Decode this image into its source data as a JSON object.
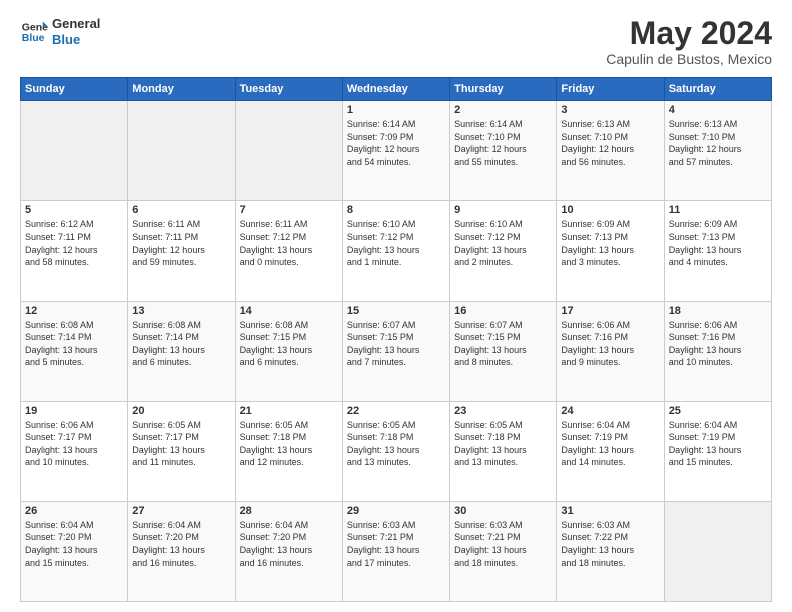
{
  "logo": {
    "line1": "General",
    "line2": "Blue"
  },
  "title": "May 2024",
  "subtitle": "Capulin de Bustos, Mexico",
  "header_days": [
    "Sunday",
    "Monday",
    "Tuesday",
    "Wednesday",
    "Thursday",
    "Friday",
    "Saturday"
  ],
  "weeks": [
    {
      "days": [
        {
          "num": "",
          "info": ""
        },
        {
          "num": "",
          "info": ""
        },
        {
          "num": "",
          "info": ""
        },
        {
          "num": "1",
          "info": "Sunrise: 6:14 AM\nSunset: 7:09 PM\nDaylight: 12 hours\nand 54 minutes."
        },
        {
          "num": "2",
          "info": "Sunrise: 6:14 AM\nSunset: 7:10 PM\nDaylight: 12 hours\nand 55 minutes."
        },
        {
          "num": "3",
          "info": "Sunrise: 6:13 AM\nSunset: 7:10 PM\nDaylight: 12 hours\nand 56 minutes."
        },
        {
          "num": "4",
          "info": "Sunrise: 6:13 AM\nSunset: 7:10 PM\nDaylight: 12 hours\nand 57 minutes."
        }
      ]
    },
    {
      "days": [
        {
          "num": "5",
          "info": "Sunrise: 6:12 AM\nSunset: 7:11 PM\nDaylight: 12 hours\nand 58 minutes."
        },
        {
          "num": "6",
          "info": "Sunrise: 6:11 AM\nSunset: 7:11 PM\nDaylight: 12 hours\nand 59 minutes."
        },
        {
          "num": "7",
          "info": "Sunrise: 6:11 AM\nSunset: 7:12 PM\nDaylight: 13 hours\nand 0 minutes."
        },
        {
          "num": "8",
          "info": "Sunrise: 6:10 AM\nSunset: 7:12 PM\nDaylight: 13 hours\nand 1 minute."
        },
        {
          "num": "9",
          "info": "Sunrise: 6:10 AM\nSunset: 7:12 PM\nDaylight: 13 hours\nand 2 minutes."
        },
        {
          "num": "10",
          "info": "Sunrise: 6:09 AM\nSunset: 7:13 PM\nDaylight: 13 hours\nand 3 minutes."
        },
        {
          "num": "11",
          "info": "Sunrise: 6:09 AM\nSunset: 7:13 PM\nDaylight: 13 hours\nand 4 minutes."
        }
      ]
    },
    {
      "days": [
        {
          "num": "12",
          "info": "Sunrise: 6:08 AM\nSunset: 7:14 PM\nDaylight: 13 hours\nand 5 minutes."
        },
        {
          "num": "13",
          "info": "Sunrise: 6:08 AM\nSunset: 7:14 PM\nDaylight: 13 hours\nand 6 minutes."
        },
        {
          "num": "14",
          "info": "Sunrise: 6:08 AM\nSunset: 7:15 PM\nDaylight: 13 hours\nand 6 minutes."
        },
        {
          "num": "15",
          "info": "Sunrise: 6:07 AM\nSunset: 7:15 PM\nDaylight: 13 hours\nand 7 minutes."
        },
        {
          "num": "16",
          "info": "Sunrise: 6:07 AM\nSunset: 7:15 PM\nDaylight: 13 hours\nand 8 minutes."
        },
        {
          "num": "17",
          "info": "Sunrise: 6:06 AM\nSunset: 7:16 PM\nDaylight: 13 hours\nand 9 minutes."
        },
        {
          "num": "18",
          "info": "Sunrise: 6:06 AM\nSunset: 7:16 PM\nDaylight: 13 hours\nand 10 minutes."
        }
      ]
    },
    {
      "days": [
        {
          "num": "19",
          "info": "Sunrise: 6:06 AM\nSunset: 7:17 PM\nDaylight: 13 hours\nand 10 minutes."
        },
        {
          "num": "20",
          "info": "Sunrise: 6:05 AM\nSunset: 7:17 PM\nDaylight: 13 hours\nand 11 minutes."
        },
        {
          "num": "21",
          "info": "Sunrise: 6:05 AM\nSunset: 7:18 PM\nDaylight: 13 hours\nand 12 minutes."
        },
        {
          "num": "22",
          "info": "Sunrise: 6:05 AM\nSunset: 7:18 PM\nDaylight: 13 hours\nand 13 minutes."
        },
        {
          "num": "23",
          "info": "Sunrise: 6:05 AM\nSunset: 7:18 PM\nDaylight: 13 hours\nand 13 minutes."
        },
        {
          "num": "24",
          "info": "Sunrise: 6:04 AM\nSunset: 7:19 PM\nDaylight: 13 hours\nand 14 minutes."
        },
        {
          "num": "25",
          "info": "Sunrise: 6:04 AM\nSunset: 7:19 PM\nDaylight: 13 hours\nand 15 minutes."
        }
      ]
    },
    {
      "days": [
        {
          "num": "26",
          "info": "Sunrise: 6:04 AM\nSunset: 7:20 PM\nDaylight: 13 hours\nand 15 minutes."
        },
        {
          "num": "27",
          "info": "Sunrise: 6:04 AM\nSunset: 7:20 PM\nDaylight: 13 hours\nand 16 minutes."
        },
        {
          "num": "28",
          "info": "Sunrise: 6:04 AM\nSunset: 7:20 PM\nDaylight: 13 hours\nand 16 minutes."
        },
        {
          "num": "29",
          "info": "Sunrise: 6:03 AM\nSunset: 7:21 PM\nDaylight: 13 hours\nand 17 minutes."
        },
        {
          "num": "30",
          "info": "Sunrise: 6:03 AM\nSunset: 7:21 PM\nDaylight: 13 hours\nand 18 minutes."
        },
        {
          "num": "31",
          "info": "Sunrise: 6:03 AM\nSunset: 7:22 PM\nDaylight: 13 hours\nand 18 minutes."
        },
        {
          "num": "",
          "info": ""
        }
      ]
    }
  ]
}
